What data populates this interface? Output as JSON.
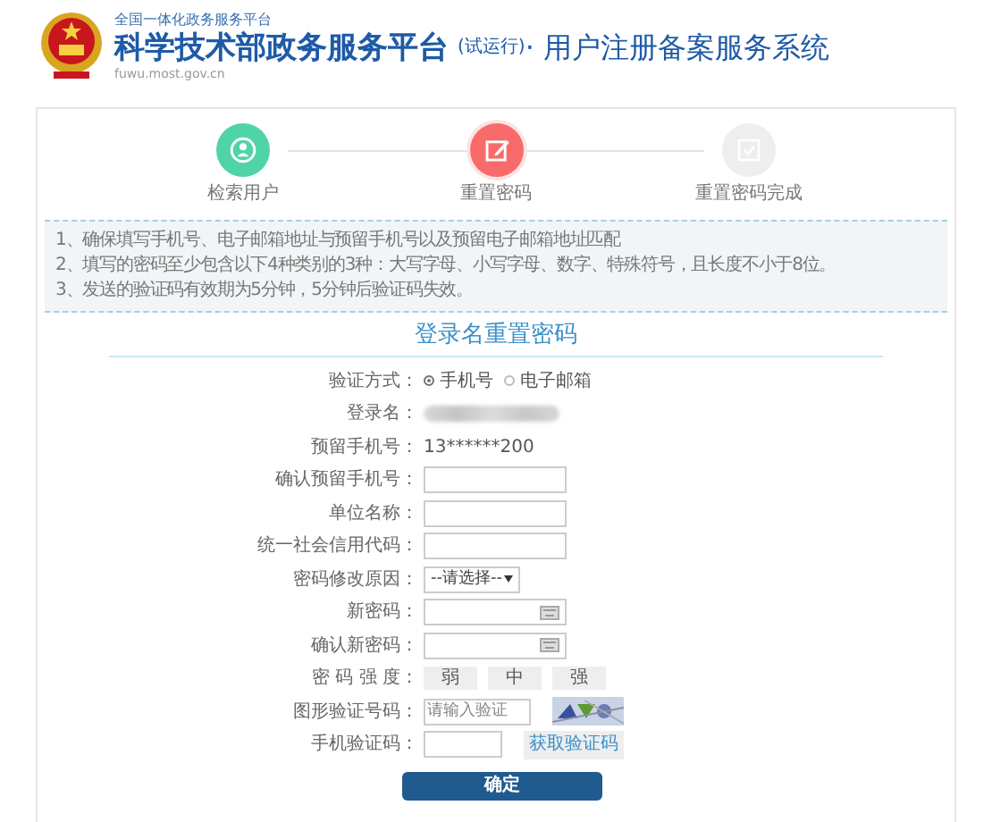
{
  "header": {
    "subtitle": "全国一体化政务服务平台",
    "title": "科学技术部政务服务平台",
    "trial": "(试运行)",
    "system": "· 用户注册备案服务系统",
    "url": "fuwu.most.gov.cn"
  },
  "steps": [
    {
      "label": "检索用户",
      "completed": true,
      "selected": false
    },
    {
      "label": "重置密码",
      "completed": false,
      "selected": true
    },
    {
      "label": "重置密码完成",
      "completed": false,
      "selected": false
    }
  ],
  "notes": [
    "1、确保填写手机号、电子邮箱地址与预留手机号以及预留电子邮箱地址匹配",
    "2、填写的密码至少包含以下4种类别的3种：大写字母、小写字母、数字、特殊符号，且长度不小于8位。",
    "3、发送的验证码有效期为5分钟，5分钟后验证码失效。"
  ],
  "form": {
    "title": "登录名重置密码",
    "rows": [
      {
        "kind": "radio",
        "label": "验证方式：",
        "options": [
          {
            "label": "手机号",
            "selected": true
          },
          {
            "label": "电子邮箱",
            "selected": false
          }
        ]
      },
      {
        "kind": "hidden",
        "label": "登录名："
      },
      {
        "kind": "text",
        "label": "预留手机号：",
        "value": "13******200"
      },
      {
        "kind": "input",
        "label": "确认预留手机号："
      },
      {
        "kind": "input",
        "label": "单位名称："
      },
      {
        "kind": "input",
        "label": "统一社会信用代码："
      },
      {
        "kind": "select",
        "label": "密码修改原因：",
        "value": "--请选择--"
      },
      {
        "kind": "password",
        "label": "新密码："
      },
      {
        "kind": "password",
        "label": "确认新密码："
      },
      {
        "kind": "strength",
        "label": "密 码 强 度：",
        "levels": [
          "弱",
          "中",
          "强"
        ]
      },
      {
        "kind": "captcha",
        "label": "图形验证号码：",
        "placeholder": "请输入验证"
      },
      {
        "kind": "sms",
        "label": "手机验证码：",
        "button": "获取验证码"
      }
    ],
    "submit": "确定"
  }
}
